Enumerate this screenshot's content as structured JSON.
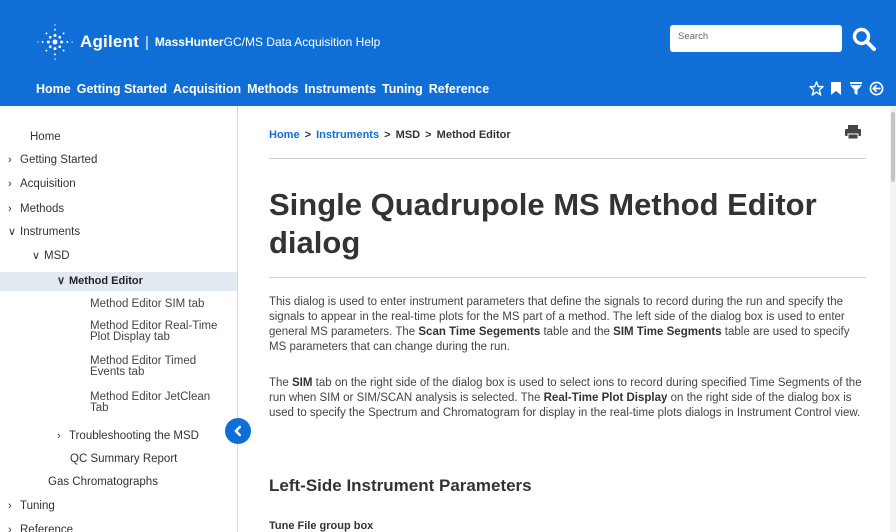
{
  "header": {
    "brand": "Agilent",
    "separator": "|",
    "product": "MassHunter",
    "product_rest": " GC/MS Data Acquisition Help",
    "search_placeholder": "Search",
    "nav": [
      "Home",
      "Getting Started",
      "Acquisition",
      "Methods",
      "Instruments",
      "Tuning",
      "Reference"
    ],
    "tools": [
      "star-icon",
      "bookmark-icon",
      "filter-icon",
      "circle-arrow-icon"
    ]
  },
  "sidebar": {
    "items": [
      {
        "label": "Home",
        "chevron": ""
      },
      {
        "label": "Getting Started",
        "chevron": ">"
      },
      {
        "label": "Acquisition",
        "chevron": ">"
      },
      {
        "label": "Methods",
        "chevron": ">"
      },
      {
        "label": "Instruments",
        "chevron": "v"
      },
      {
        "label": "MSD",
        "chevron": "v"
      },
      {
        "label": "Method Editor",
        "chevron": "v"
      },
      {
        "label": "Method Editor SIM tab"
      },
      {
        "label": "Method Editor Real-Time Plot Display tab"
      },
      {
        "label": "Method Editor Timed Events tab"
      },
      {
        "label": "Method Editor JetClean Tab"
      },
      {
        "label": "Troubleshooting the MSD",
        "chevron": ">"
      },
      {
        "label": "QC Summary Report"
      },
      {
        "label": "Gas Chromatographs"
      },
      {
        "label": "Tuning",
        "chevron": ">"
      },
      {
        "label": "Reference",
        "chevron": ">"
      }
    ]
  },
  "main": {
    "breadcrumb": {
      "home": "Home",
      "sep": ">",
      "instruments": "Instruments",
      "msd": "MSD",
      "current": "Method Editor"
    },
    "title": "Single Quadrupole MS Method Editor dialog",
    "para1_a": "This dialog is used to enter instrument parameters that define the signals to record during the run and specify the signals to appear in the real-time plots for the MS part of a method. The left side of the dialog box is used to enter general MS parameters. The ",
    "para1_b": "Scan Time Segements",
    "para1_c": " table and the ",
    "para1_d": "SIM Time Segments",
    "para1_e": " table are used to specify MS parameters that can change during the run.",
    "para2_a": "The ",
    "para2_b": "SIM",
    "para2_c": " tab on the right side of the dialog box is used to select ions to record during specified Time Segments of the run when SIM or SIM/SCAN analysis is selected. The ",
    "para2_d": "Real-Time Plot Display",
    "para2_e": " on the right side of the dialog box is used to specify the Spectrum and Chromatogram for display in the real-time plots dialogs in Instrument Control view.",
    "section_heading": "Left-Side Instrument Parameters",
    "subheading": "Tune File group box"
  },
  "colors": {
    "accent": "#0f6fd6",
    "active_bg": "#e2e9f1"
  }
}
